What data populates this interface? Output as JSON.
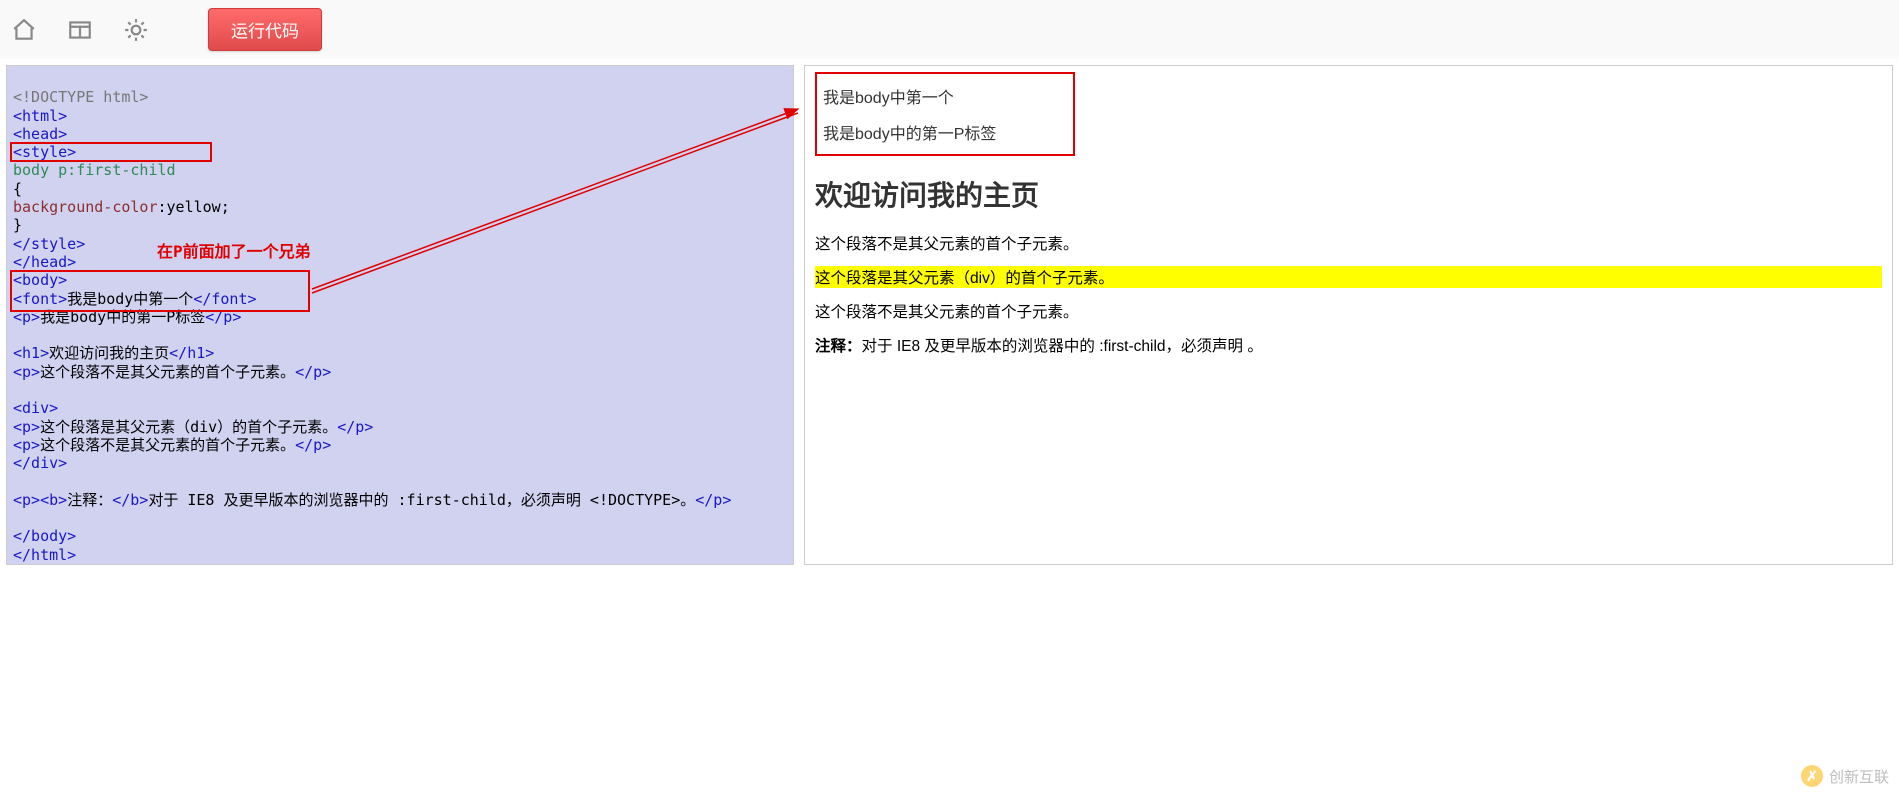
{
  "toolbar": {
    "run_label": "运行代码"
  },
  "annotations": {
    "added_sibling": "在P前面加了一个兄弟"
  },
  "code": {
    "l1_doctype": "<!DOCTYPE html>",
    "l2_html_open": "<html>",
    "l3_head_open": "<head>",
    "l4_style_open": "<style>",
    "l5_selector": "body p:first-child",
    "l6_brace_open": "{",
    "l7_prop": "background-color",
    "l7_colon": ":",
    "l7_value": "yellow;",
    "l8_brace_close": "}",
    "l9_style_close": "</style>",
    "l10_head_close": "</head>",
    "l11_body_open": "<body>",
    "l12_font_open": "<font>",
    "l12_font_text": "我是body中第一个",
    "l12_font_close": "</font>",
    "l13_p_open": "<p>",
    "l13_p_text": "我是body中的第一P标签",
    "l13_p_close": "</p>",
    "l15_h1_open": "<h1>",
    "l15_h1_text": "欢迎访问我的主页",
    "l15_h1_close": "</h1>",
    "l16_p_open": "<p>",
    "l16_p_text": "这个段落不是其父元素的首个子元素。",
    "l16_p_close": "</p>",
    "l18_div_open": "<div>",
    "l19_p_open": "<p>",
    "l19_p_text": "这个段落是其父元素（div）的首个子元素。",
    "l19_p_close": "</p>",
    "l20_p_open": "<p>",
    "l20_p_text": "这个段落不是其父元素的首个子元素。",
    "l20_p_close": "</p>",
    "l21_div_close": "</div>",
    "l23_p_open": "<p>",
    "l23_b_open": "<b>",
    "l23_b_text": "注释：",
    "l23_b_close": "</b>",
    "l23_tail": "对于 IE8 及更早版本的浏览器中的 :first-child，必须声明 <!DOCTYPE>。",
    "l23_p_close": "</p>",
    "l25_body_close": "</body>",
    "l26_html_close": "</html>"
  },
  "result": {
    "out1": "我是body中第一个",
    "out2": "我是body中的第一P标签",
    "h1": "欢迎访问我的主页",
    "p1": "这个段落不是其父元素的首个子元素。",
    "p2": "这个段落是其父元素（div）的首个子元素。",
    "p3": "这个段落不是其父元素的首个子元素。",
    "note_bold": "注释：",
    "note_tail": "对于 IE8 及更早版本的浏览器中的 :first-child，必须声明 。"
  },
  "watermark": {
    "label": "创新互联"
  }
}
